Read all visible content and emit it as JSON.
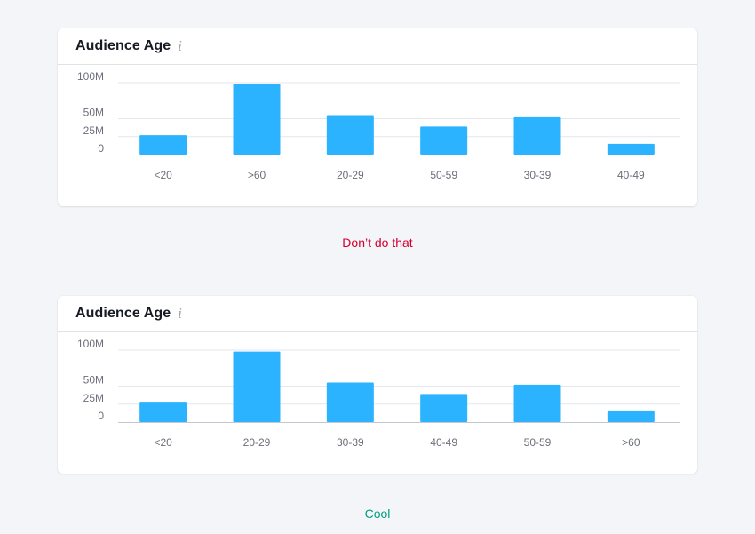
{
  "colors": {
    "bar": "#2bb3ff",
    "grid": "#e6e7ed",
    "axis": "#c4c7cf",
    "tick_text": "#6c6e79",
    "bad_caption": "#d1002f",
    "good_caption": "#009f81"
  },
  "chart_data": [
    {
      "type": "bar",
      "title": "Audience Age",
      "info_icon": "info-icon",
      "categories": [
        "<20",
        ">60",
        "20-29",
        "50-59",
        "30-39",
        "40-49"
      ],
      "values": [
        27,
        98,
        55,
        39,
        52,
        15
      ],
      "yticks": [
        0,
        25,
        50,
        100
      ],
      "ytick_labels": [
        "0",
        "25M",
        "50M",
        "100M"
      ],
      "ylim": [
        0,
        100
      ],
      "caption": "Don’t do that"
    },
    {
      "type": "bar",
      "title": "Audience Age",
      "info_icon": "info-icon",
      "categories": [
        "<20",
        "20-29",
        "30-39",
        "40-49",
        "50-59",
        ">60"
      ],
      "values": [
        27,
        98,
        55,
        39,
        52,
        15
      ],
      "yticks": [
        0,
        25,
        50,
        100
      ],
      "ytick_labels": [
        "0",
        "25M",
        "50M",
        "100M"
      ],
      "ylim": [
        0,
        100
      ],
      "caption": "Cool"
    }
  ]
}
